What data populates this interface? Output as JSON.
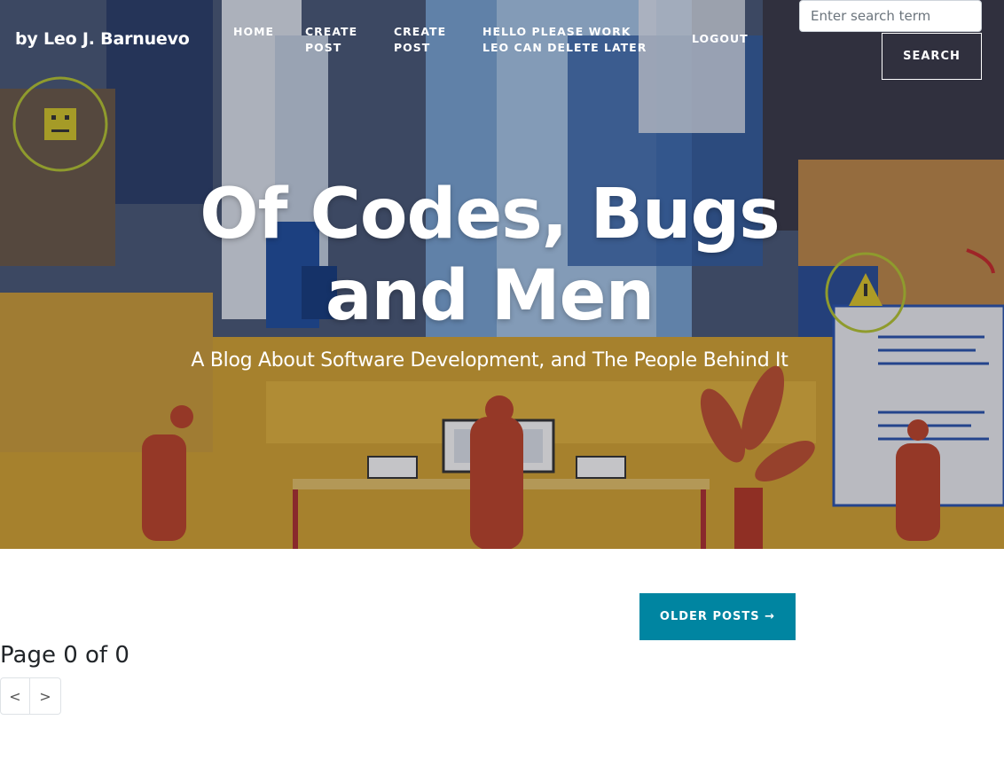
{
  "navbar": {
    "brand": "by Leo J. Barnuevo",
    "links": [
      {
        "label": "HOME"
      },
      {
        "label": "CREATE POST"
      },
      {
        "label": "CREATE POST"
      },
      {
        "label": "HELLO PLEASE WORK LEO CAN DELETE LATER"
      },
      {
        "label": "LOGOUT"
      }
    ],
    "search": {
      "placeholder": "Enter search term",
      "button_label": "SEARCH"
    }
  },
  "hero": {
    "title": "Of Codes, Bugs and Men",
    "subtitle": "A Blog About Software Development, and The People Behind It"
  },
  "content": {
    "older_posts_label": "OLDER POSTS →",
    "page_info": "Page 0 of 0",
    "pager": {
      "prev": "<",
      "next": ">"
    }
  },
  "colors": {
    "accent": "#0085a1",
    "nav_text": "#ffffff"
  }
}
